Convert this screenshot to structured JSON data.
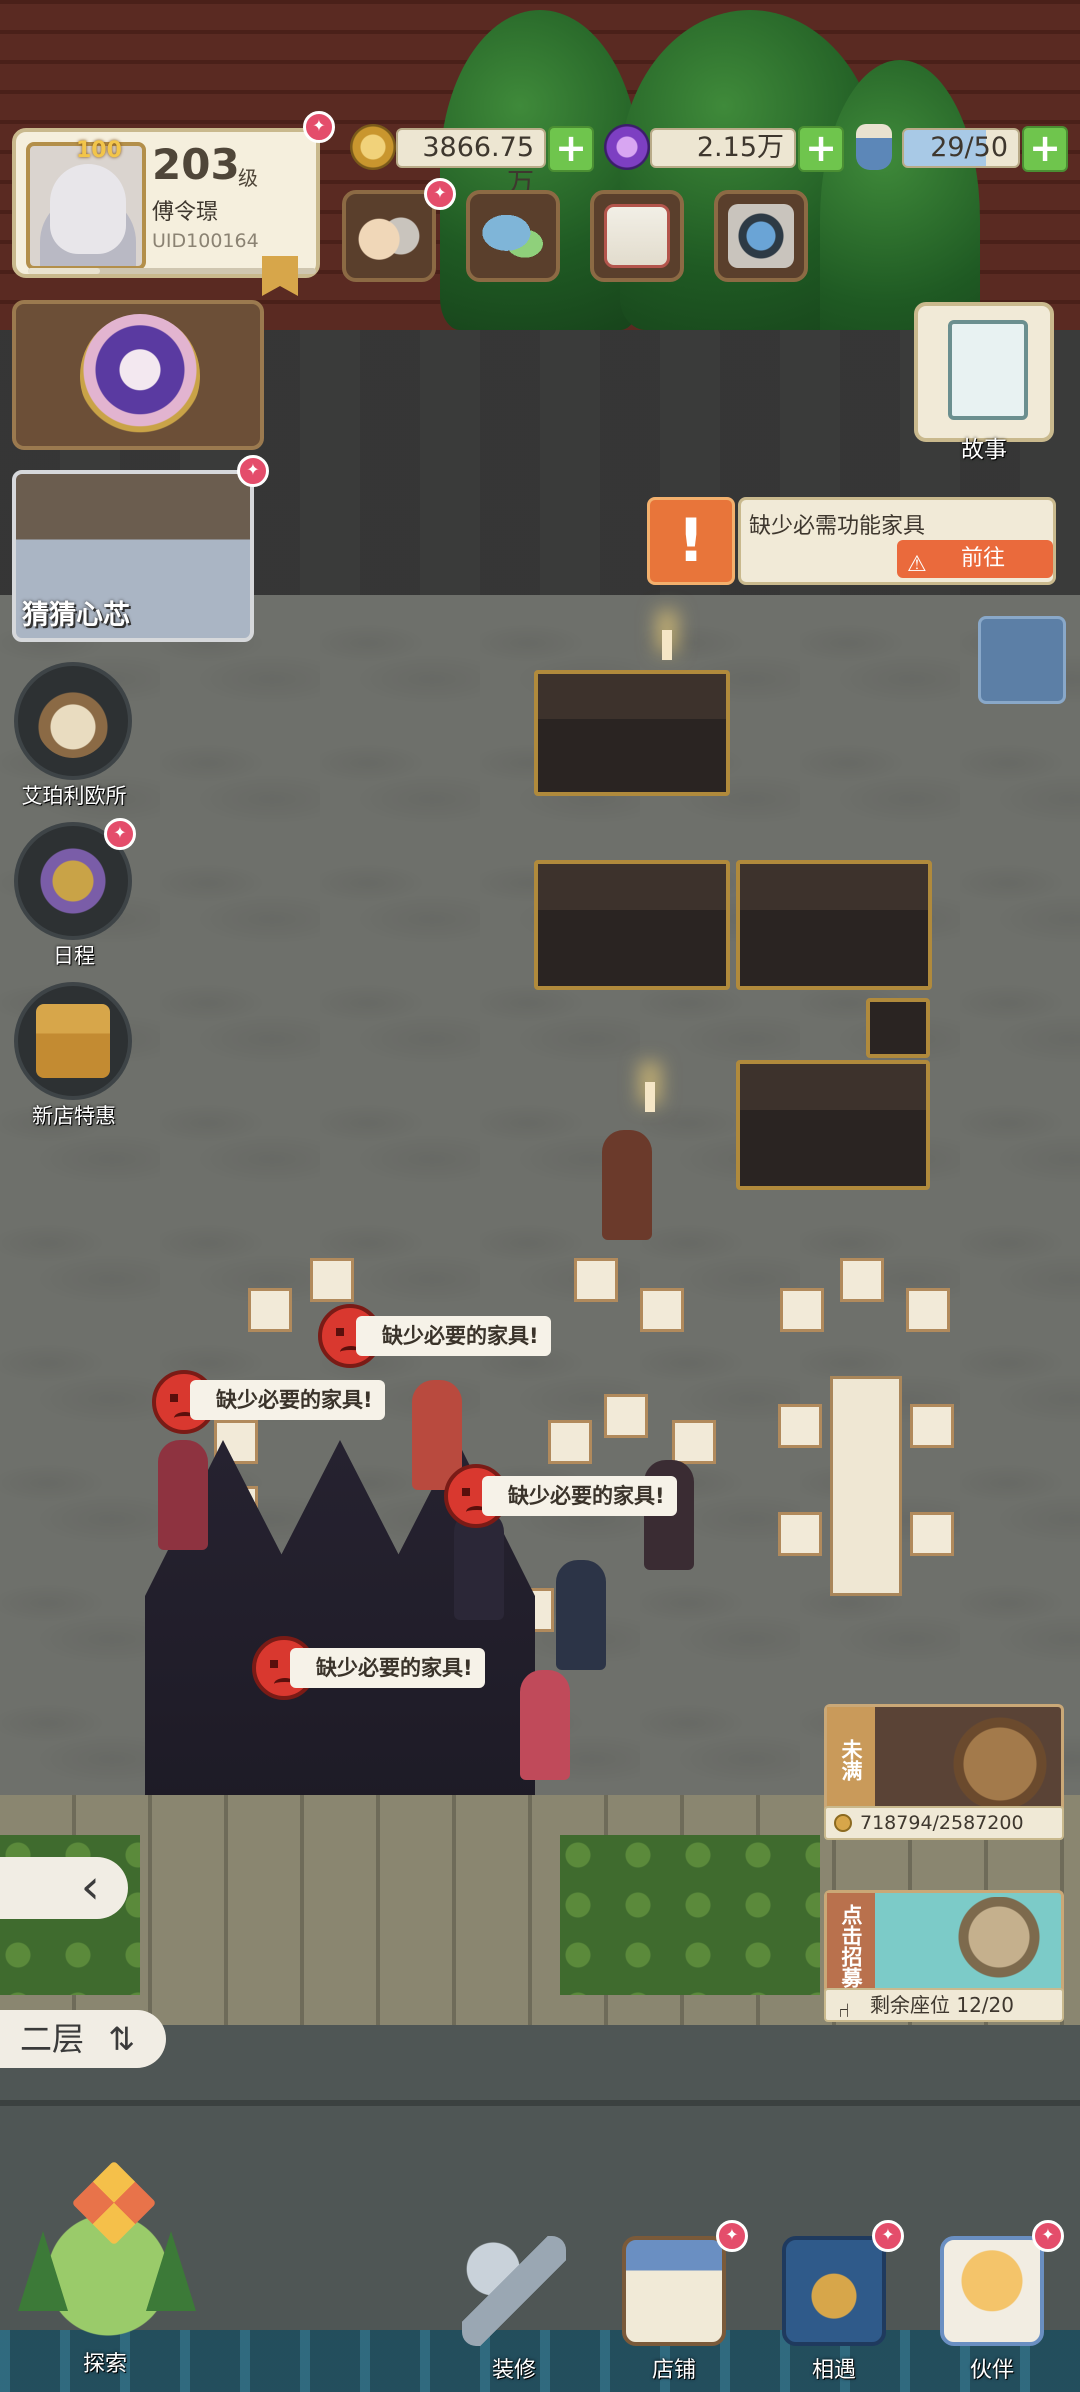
{
  "player": {
    "level_badge": "100",
    "level": "203",
    "level_unit": "级",
    "name": "傅令璟",
    "uid": "UID100164",
    "xp_progress": 0.25
  },
  "resources": [
    {
      "icon": "coin-icon",
      "value": "3866.75万",
      "plus": "+"
    },
    {
      "icon": "gem-icon",
      "value": "2.15万",
      "plus": "+"
    },
    {
      "icon": "potion-icon",
      "value": "29/50",
      "plus": "+"
    }
  ],
  "top_menu": [
    "cats-icon",
    "chat-icon",
    "mail-icon",
    "camera-icon"
  ],
  "side_menu": {
    "guess": "猜猜心芯",
    "detective": "艾珀利欧所",
    "schedule": "日程",
    "new_shop": "新店特惠",
    "story": "故事"
  },
  "alert": {
    "message": "缺少必需功能家具",
    "go": "前往"
  },
  "bubbles": [
    "缺少必要的家具!",
    "缺少必要的家具!",
    "缺少必要的家具!",
    "缺少必要的家具!"
  ],
  "controls": {
    "back": "‹",
    "floor": "二层",
    "floor_switch": "⇅"
  },
  "boss": {
    "tag": "未满",
    "progress": "718794/2587200"
  },
  "recruit": {
    "tag": "点击招募",
    "seats": "剩余座位 12/20"
  },
  "nav": {
    "explore": "探索",
    "renovate": "装修",
    "shop": "店铺",
    "encounter": "相遇",
    "partner": "伙伴"
  },
  "badge_dot": "✦",
  "colors": {
    "plus_button": "#6fc54d",
    "alert": "#ea6a3c",
    "notify_dot": "#e44d6b"
  }
}
